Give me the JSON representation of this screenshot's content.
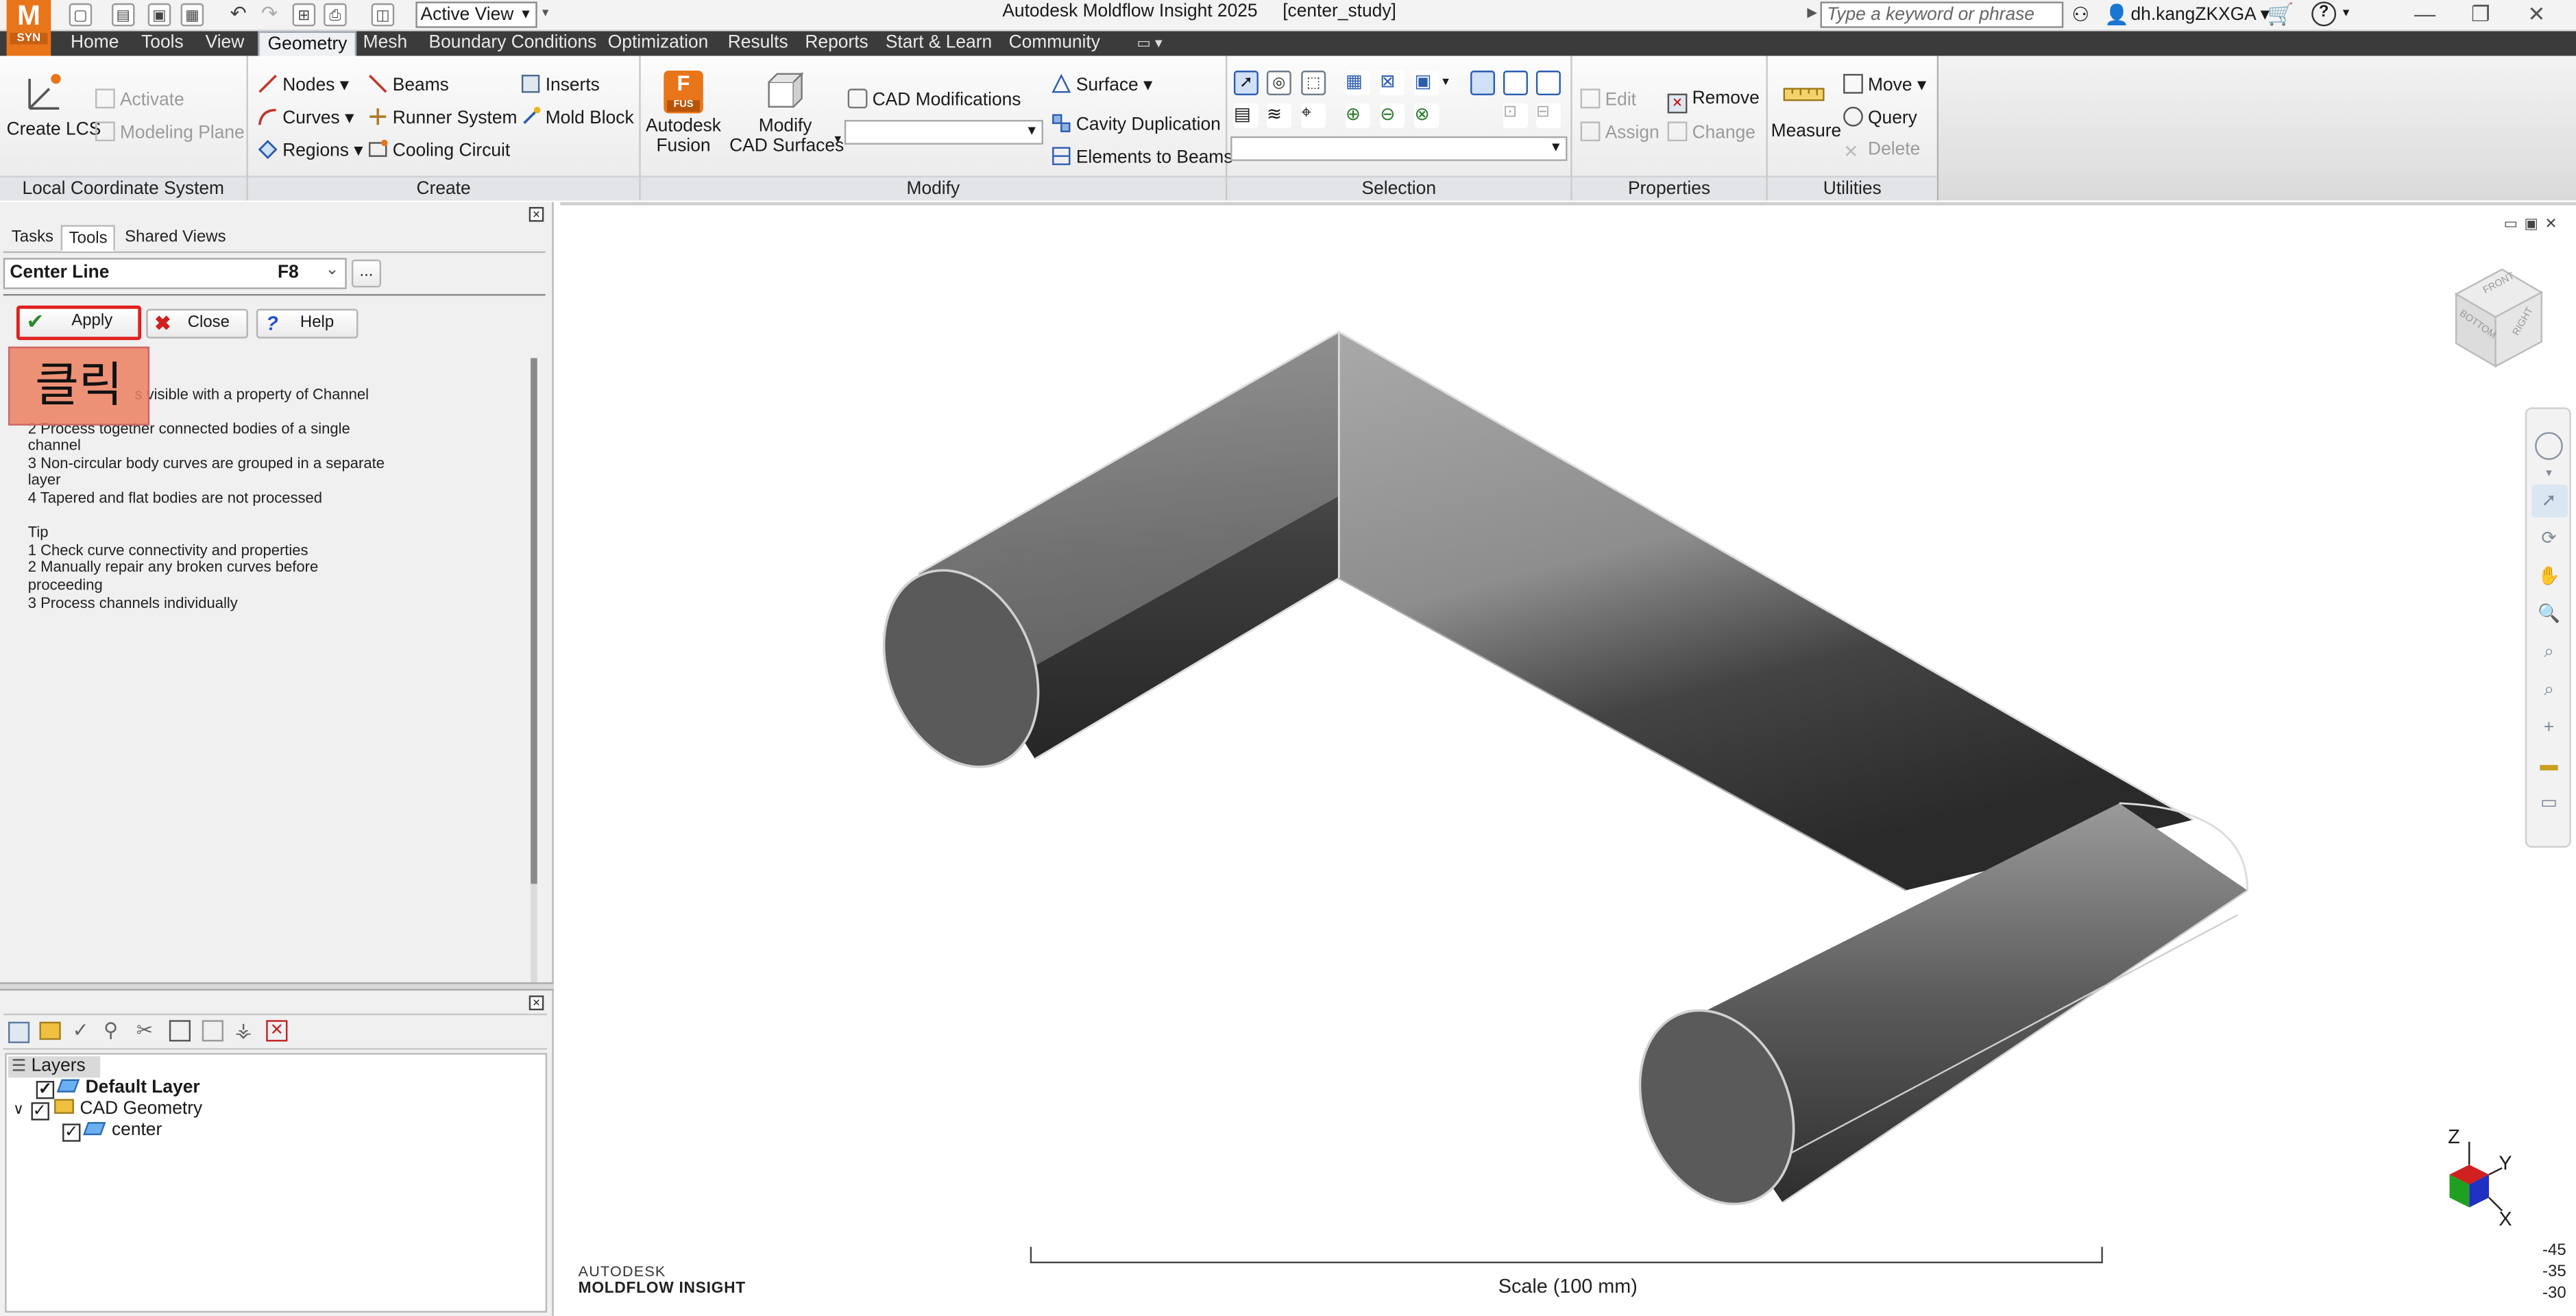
{
  "app": {
    "logo_letter": "M",
    "logo_sub": "SYN",
    "title": "Autodesk Moldflow Insight 2025",
    "study": "[center_study]",
    "active_view": "Active View",
    "search_placeholder": "Type a keyword or phrase",
    "user": "dh.kangZKXGA"
  },
  "tabs": [
    "Home",
    "Tools",
    "View",
    "Geometry",
    "Mesh",
    "Boundary Conditions",
    "Optimization",
    "Results",
    "Reports",
    "Start & Learn",
    "Community"
  ],
  "active_tab": "Geometry",
  "ribbon": {
    "lcs": {
      "create": "Create LCS",
      "activate": "Activate",
      "modeling_plane": "Modeling Plane",
      "label": "Local Coordinate System"
    },
    "create": {
      "nodes": "Nodes",
      "curves": "Curves",
      "regions": "Regions",
      "beams": "Beams",
      "runner_system": "Runner System",
      "cooling_circuit": "Cooling Circuit",
      "inserts": "Inserts",
      "mold_block": "Mold Block",
      "label": "Create"
    },
    "modify": {
      "fusion_line1": "Autodesk",
      "fusion_line2": "Fusion",
      "fusion_badge": "FUS",
      "modify_line1": "Modify",
      "modify_line2": "CAD Surfaces",
      "cad_mod": "CAD Modifications",
      "surface": "Surface",
      "cavity_dup": "Cavity Duplication",
      "elements_to_beams": "Elements to Beams",
      "label": "Modify"
    },
    "selection": {
      "label": "Selection"
    },
    "properties": {
      "edit": "Edit",
      "assign": "Assign",
      "remove": "Remove",
      "change": "Change",
      "label": "Properties"
    },
    "utilities": {
      "measure": "Measure",
      "move": "Move",
      "query": "Query",
      "delete": "Delete",
      "label": "Utilities"
    }
  },
  "panel": {
    "tabs": [
      "Tasks",
      "Tools",
      "Shared Views"
    ],
    "active_tab": "Tools",
    "tool_name": "Center Line",
    "shortcut": "F8",
    "more": "...",
    "apply": "Apply",
    "close": "Close",
    "help": "Help",
    "overlay": "클릭",
    "help_lines": [
      "1 Only visible with a property of Channel",
      "2 Process together connected bodies of a single channel",
      "3 Non-circular body curves are grouped in a separate layer",
      "4 Tapered and flat bodies are not processed",
      "",
      "Tip",
      "1 Check curve connectivity and properties",
      "2 Manually repair any broken curves before proceeding",
      "3 Process channels individually"
    ],
    "help_lines_display_1": "s visible with a property of Channel"
  },
  "layers": {
    "title": "Layers",
    "items": [
      {
        "name": "Default Layer",
        "checked": true,
        "bold": true
      },
      {
        "name": "CAD Geometry",
        "checked": true,
        "bold": false
      },
      {
        "name": "center",
        "checked": true,
        "bold": false
      }
    ]
  },
  "viewport": {
    "brand_line1": "AUTODESK",
    "brand_line2": "MOLDFLOW INSIGHT",
    "scale": "Scale (100 mm)",
    "axis_z": "Z",
    "axis_y": "Y",
    "axis_x": "X",
    "viewcube_front": "FRONT",
    "viewcube_right": "RIGHT",
    "viewcube_bottom": "BOTTOM",
    "angles": [
      "-45",
      "-35",
      "-30"
    ]
  },
  "colors": {
    "accent": "#e8751a",
    "highlight": "#e02020",
    "tabbar": "#3b3b3b"
  }
}
